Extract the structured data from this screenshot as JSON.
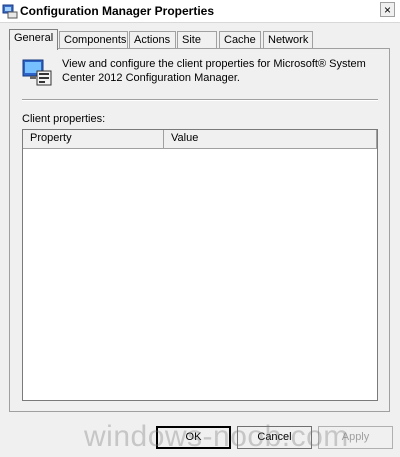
{
  "window": {
    "title": "Configuration Manager Properties",
    "close_label": "×"
  },
  "tabs": [
    {
      "label": "General",
      "active": true
    },
    {
      "label": "Components",
      "active": false
    },
    {
      "label": "Actions",
      "active": false
    },
    {
      "label": "Site",
      "active": false
    },
    {
      "label": "Cache",
      "active": false
    },
    {
      "label": "Network",
      "active": false
    }
  ],
  "general": {
    "description": "View and configure the client properties for Microsoft® System Center 2012 Configuration Manager.",
    "client_properties_label": "Client properties:",
    "columns": [
      "Property",
      "Value"
    ]
  },
  "buttons": {
    "ok": "OK",
    "cancel": "Cancel",
    "apply": "Apply"
  },
  "watermark": "windows-noob.com"
}
